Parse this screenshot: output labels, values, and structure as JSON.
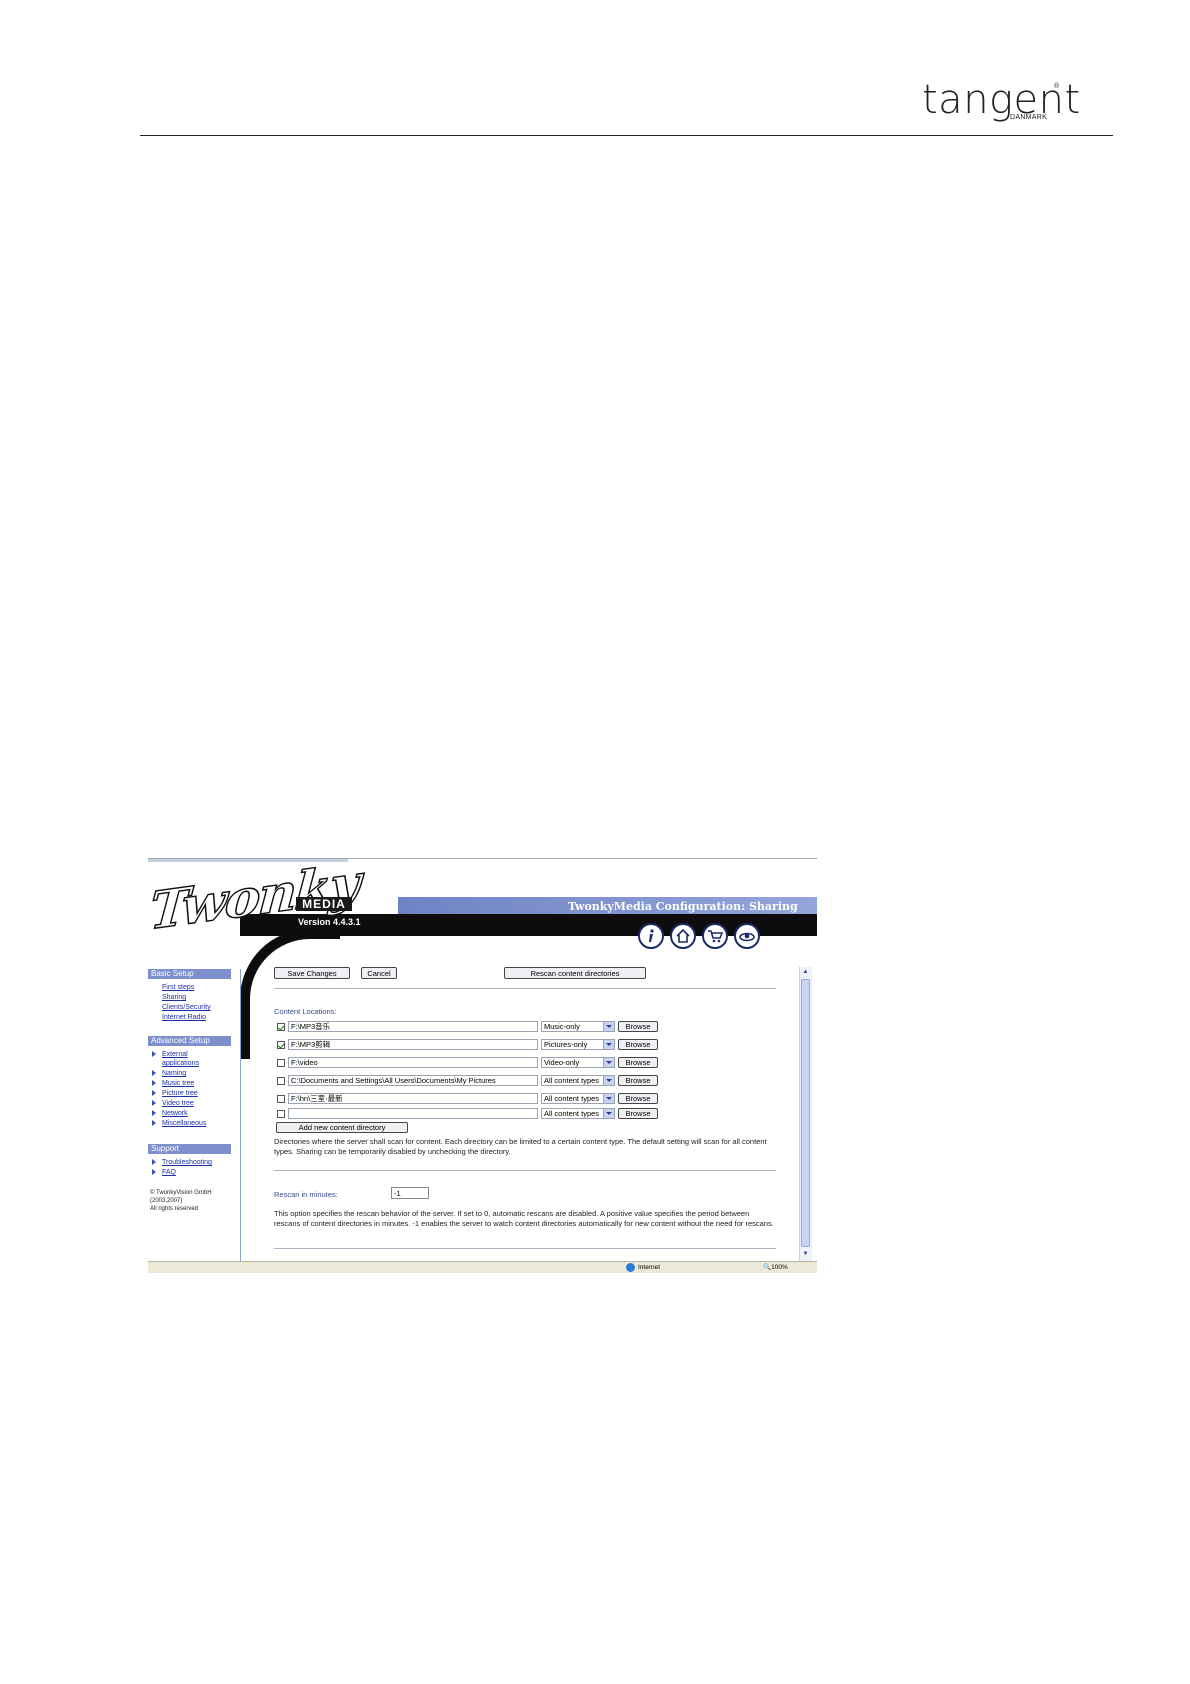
{
  "document": {
    "logo": {
      "word": "tangent",
      "registered": "®",
      "sub": "DANMARK"
    }
  },
  "app": {
    "product": "Twonky",
    "media_label": "MEDIA",
    "version": "Version 4.4.3.1",
    "page_title": "TwonkyMedia Configuration: Sharing",
    "nav_icons": [
      "info-icon",
      "home-icon",
      "cart-icon",
      "eye-icon"
    ]
  },
  "sidebar": {
    "basic_title": "Basic Setup",
    "basic_items": [
      "First steps",
      "Sharing",
      "Clients/Security",
      "Internet Radio"
    ],
    "advanced_title": "Advanced Setup",
    "advanced_items": [
      "External applications",
      "Naming",
      "Music tree",
      "Picture tree",
      "Video tree",
      "Network",
      "Miscellaneous"
    ],
    "support_title": "Support",
    "support_items": [
      "Troubleshooting",
      "FAQ"
    ],
    "copyright_1": "© TwonkyVision GmbH",
    "copyright_2": "(2003,2007)",
    "copyright_3": "All rights reserved"
  },
  "toolbar": {
    "save_label": "Save Changes",
    "cancel_label": "Cancel",
    "rescan_label": "Rescan content directories"
  },
  "content": {
    "section_label": "Content Locations:",
    "rows": [
      {
        "checked": true,
        "path": "F:\\MP3音乐",
        "type": "Music-only",
        "browse": "Browse"
      },
      {
        "checked": true,
        "path": "F:\\MP3剪辑",
        "type": "Pictures-only",
        "browse": "Browse"
      },
      {
        "checked": false,
        "path": "F:\\video",
        "type": "Video-only",
        "browse": "Browse"
      },
      {
        "checked": false,
        "path": "C:\\Documents and Settings\\All Users\\Documents\\My Pictures",
        "type": "All content types",
        "browse": "Browse"
      },
      {
        "checked": false,
        "path": "F:\\hn\\三室·最新",
        "type": "All content types",
        "browse": "Browse"
      },
      {
        "checked": false,
        "path": "",
        "type": "All content types",
        "browse": "Browse"
      }
    ],
    "add_label": "Add new content directory",
    "description": "Directories where the server shall scan for content. Each directory can be limited to a certain content type. The default setting will scan for all content types. Sharing can be temporarily disabled by unchecking the directory."
  },
  "rescan": {
    "label": "Rescan in minutes:",
    "value": "-1",
    "description": "This option specifies the rescan behavior of the server. If set to 0, automatic rescans are disabled. A positive value specifies the period between rescans of content directories in minutes. -1 enables the server to watch content directories automatically for new content without the need for rescans."
  },
  "statusbar": {
    "zone": "Internet",
    "zoom": "100%"
  }
}
